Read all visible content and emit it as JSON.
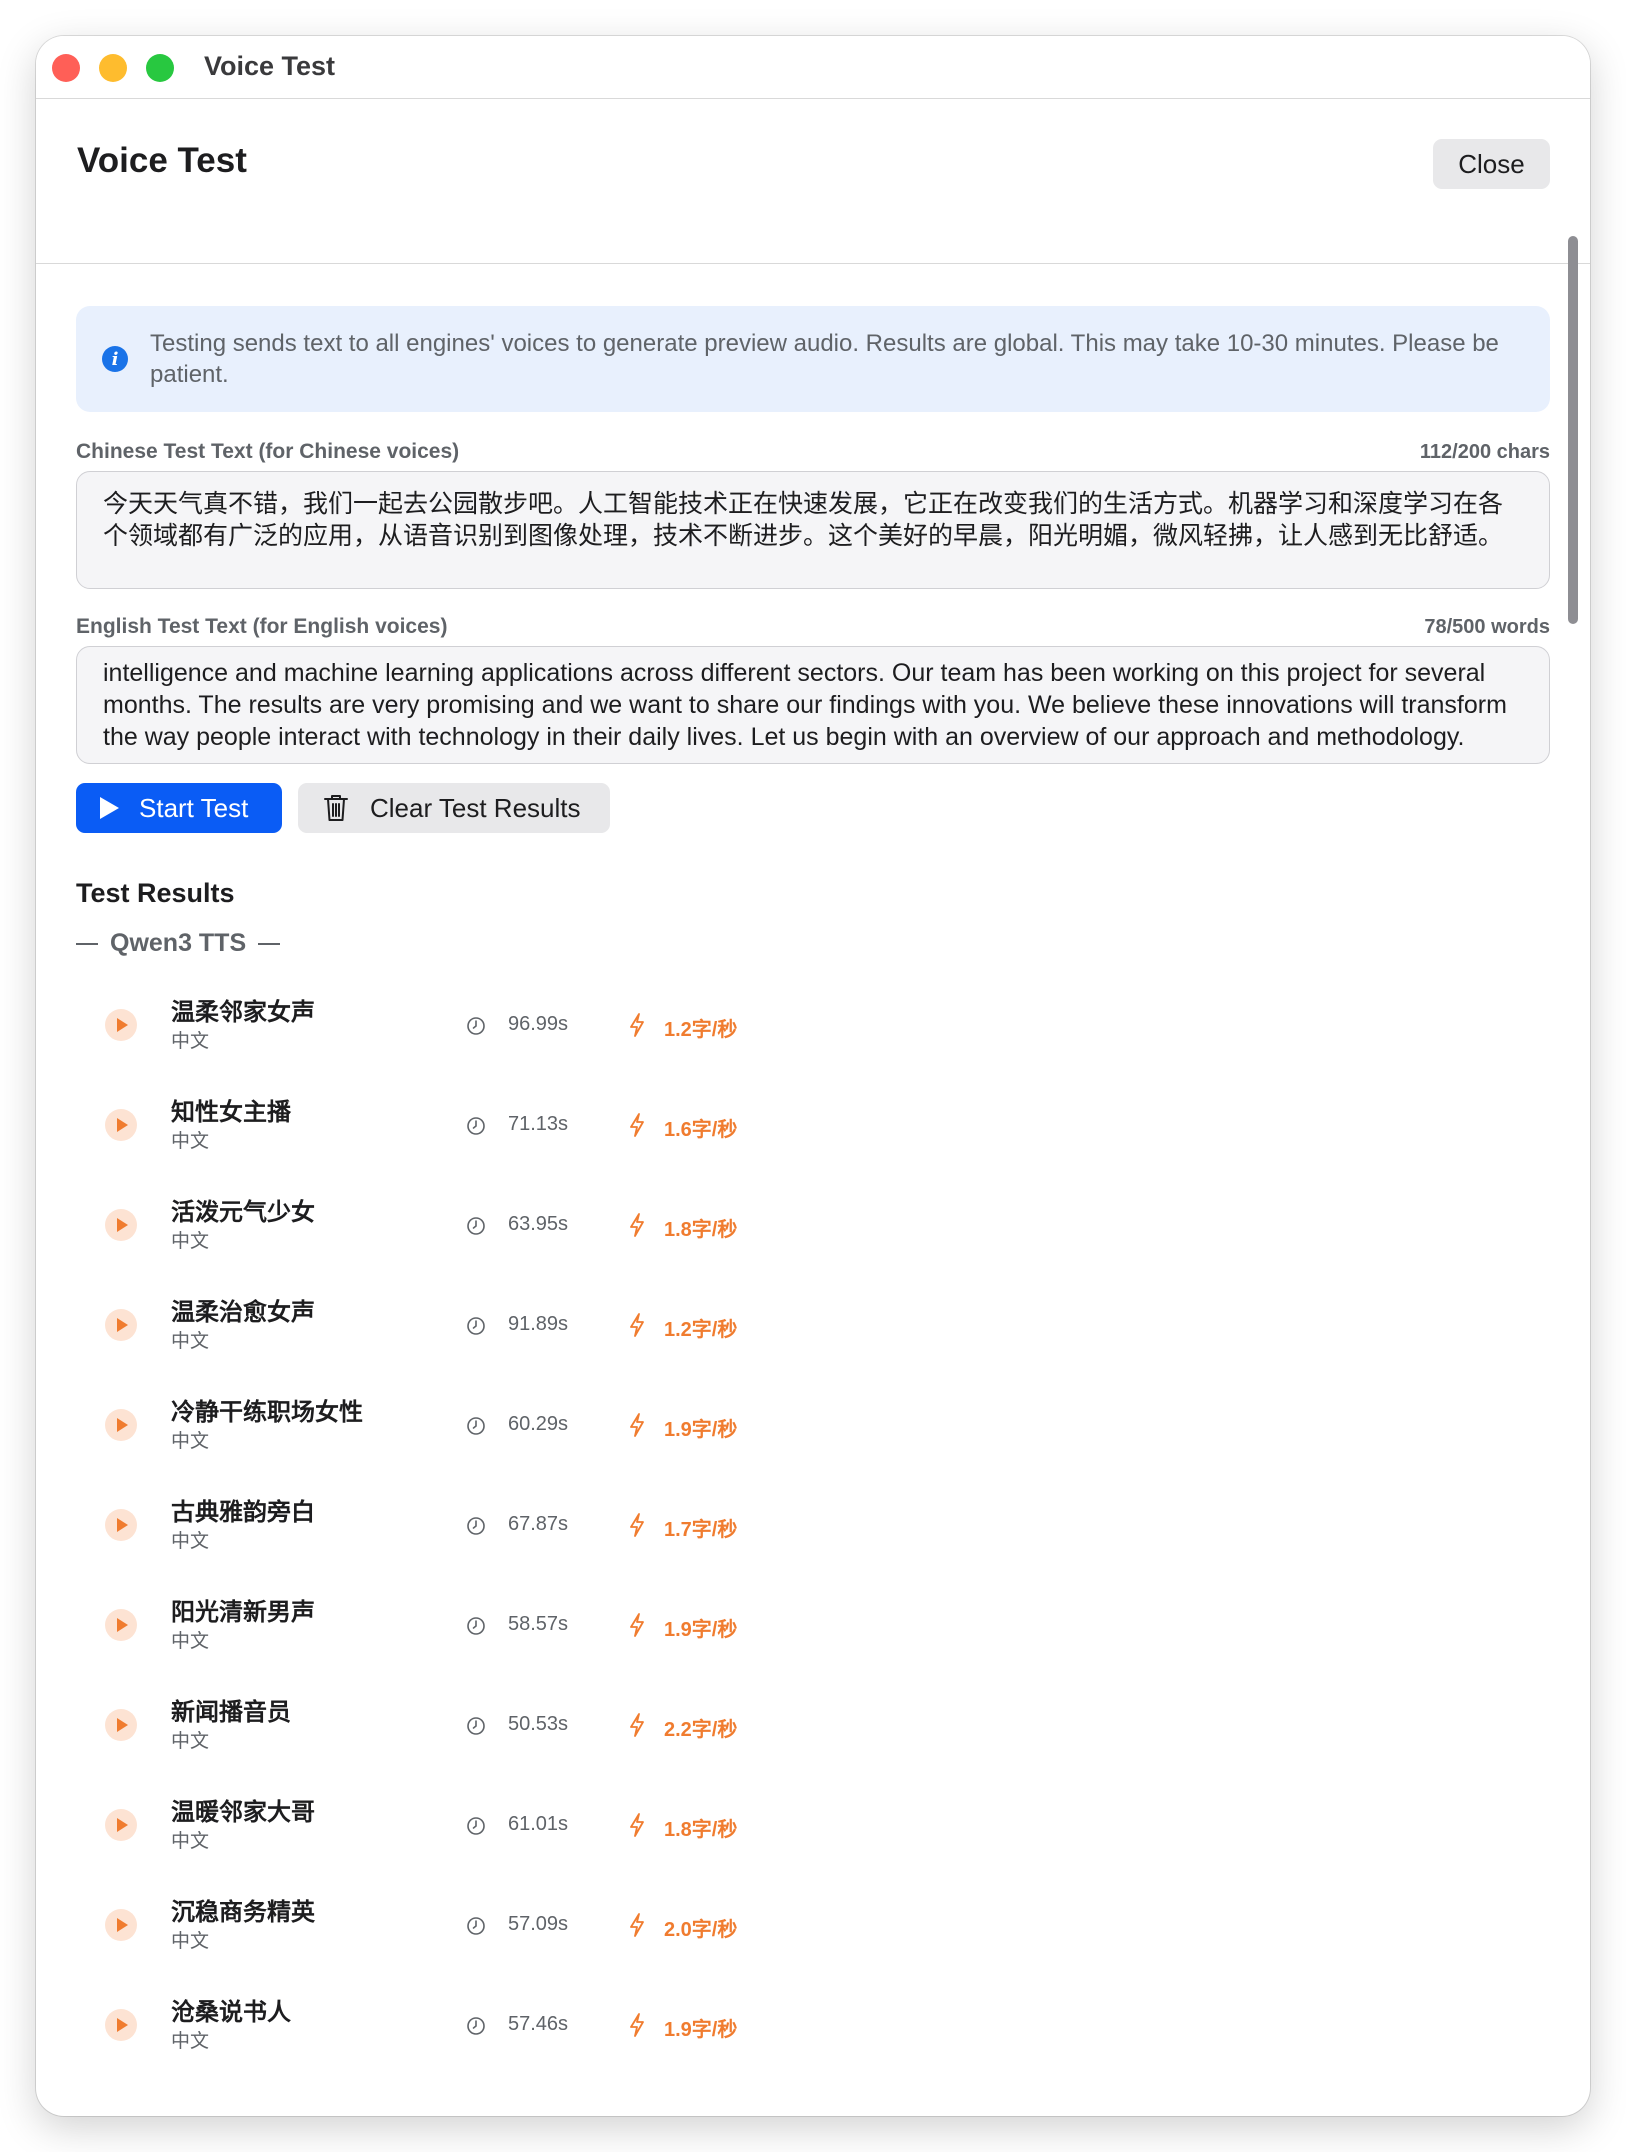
{
  "window": {
    "title": "Voice Test"
  },
  "header": {
    "title": "Voice Test",
    "close_label": "Close"
  },
  "info": {
    "icon": "info-icon",
    "text": "Testing sends text to all engines' voices to generate preview audio. Results are global. This may take 10-30 minutes. Please be patient."
  },
  "chinese": {
    "label": "Chinese Test Text (for Chinese voices)",
    "count": "112/200 chars",
    "value": "今天天气真不错，我们一起去公园散步吧。人工智能技术正在快速发展，它正在改变我们的生活方式。机器学习和深度学习在各个领域都有广泛的应用，从语音识别到图像处理，技术不断进步。这个美好的早晨，阳光明媚，微风轻拂，让人感到无比舒适。"
  },
  "english": {
    "label": "English Test Text (for English voices)",
    "count": "78/500 words",
    "value": "intelligence and machine learning applications across different sectors. Our team has been working on this project for several months. The results are very promising and we want to share our findings with you. We believe these innovations will transform the way people interact with technology in their daily lives. Let us begin with an overview of our approach and methodology."
  },
  "actions": {
    "start_label": "Start Test",
    "clear_label": "Clear Test Results"
  },
  "results": {
    "title": "Test Results",
    "group": "Qwen3 TTS",
    "items": [
      {
        "name": "温柔邻家女声",
        "lang": "中文",
        "duration": "96.99s",
        "speed": "1.2字/秒"
      },
      {
        "name": "知性女主播",
        "lang": "中文",
        "duration": "71.13s",
        "speed": "1.6字/秒"
      },
      {
        "name": "活泼元气少女",
        "lang": "中文",
        "duration": "63.95s",
        "speed": "1.8字/秒"
      },
      {
        "name": "温柔治愈女声",
        "lang": "中文",
        "duration": "91.89s",
        "speed": "1.2字/秒"
      },
      {
        "name": "冷静干练职场女性",
        "lang": "中文",
        "duration": "60.29s",
        "speed": "1.9字/秒"
      },
      {
        "name": "古典雅韵旁白",
        "lang": "中文",
        "duration": "67.87s",
        "speed": "1.7字/秒"
      },
      {
        "name": "阳光清新男声",
        "lang": "中文",
        "duration": "58.57s",
        "speed": "1.9字/秒"
      },
      {
        "name": "新闻播音员",
        "lang": "中文",
        "duration": "50.53s",
        "speed": "2.2字/秒"
      },
      {
        "name": "温暖邻家大哥",
        "lang": "中文",
        "duration": "61.01s",
        "speed": "1.8字/秒"
      },
      {
        "name": "沉稳商务精英",
        "lang": "中文",
        "duration": "57.09s",
        "speed": "2.0字/秒"
      },
      {
        "name": "沧桑说书人",
        "lang": "中文",
        "duration": "57.46s",
        "speed": "1.9字/秒"
      }
    ]
  },
  "colors": {
    "accent": "#0a5cf5",
    "speed": "#f07c2f",
    "info_bg": "#e8f0fd"
  }
}
